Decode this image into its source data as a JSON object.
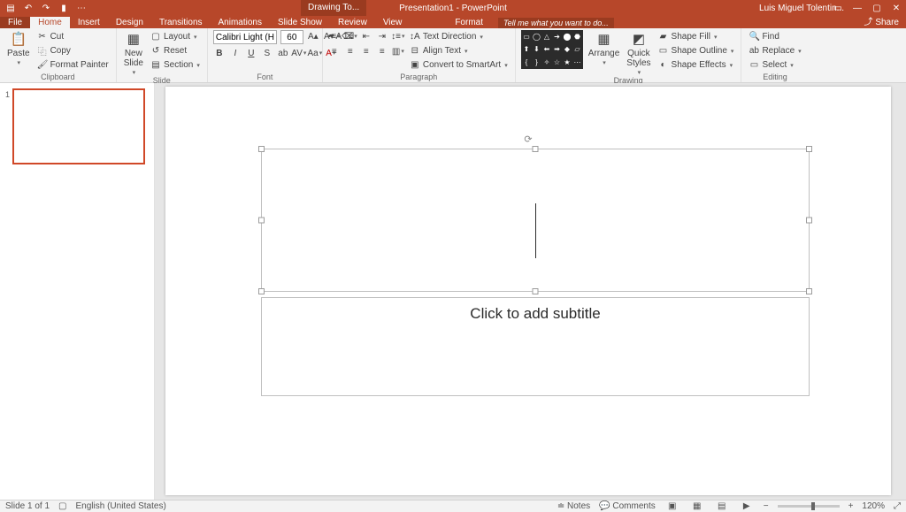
{
  "title": "Presentation1 - PowerPoint",
  "context_tab": "Drawing To...",
  "user": "Luis Miguel Tolentin...",
  "share": "Share",
  "tell_me": "Tell me what you want to do...",
  "tabs": {
    "file": "File",
    "home": "Home",
    "insert": "Insert",
    "design": "Design",
    "transitions": "Transitions",
    "animations": "Animations",
    "slideshow": "Slide Show",
    "review": "Review",
    "view": "View",
    "format": "Format"
  },
  "clipboard": {
    "paste": "Paste",
    "cut": "Cut",
    "copy": "Copy",
    "painter": "Format Painter",
    "label": "Clipboard"
  },
  "slides": {
    "new": "New\nSlide",
    "layout": "Layout",
    "reset": "Reset",
    "section": "Section",
    "label": "Slide"
  },
  "font": {
    "name": "Calibri Light (H",
    "size": "60",
    "label": "Font"
  },
  "paragraph": {
    "dir": "Text Direction",
    "align": "Align Text",
    "smart": "Convert to SmartArt",
    "label": "Paragraph"
  },
  "drawing": {
    "arrange": "Arrange",
    "quick": "Quick\nStyles",
    "fill": "Shape Fill",
    "outline": "Shape Outline",
    "effects": "Shape Effects",
    "label": "Drawing"
  },
  "editing": {
    "find": "Find",
    "replace": "Replace",
    "select": "Select",
    "label": "Editing"
  },
  "placeholder": {
    "subtitle": "Click to add subtitle"
  },
  "status": {
    "slide": "Slide 1 of 1",
    "lang": "English (United States)",
    "notes": "Notes",
    "comments": "Comments",
    "zoom": "120%"
  }
}
